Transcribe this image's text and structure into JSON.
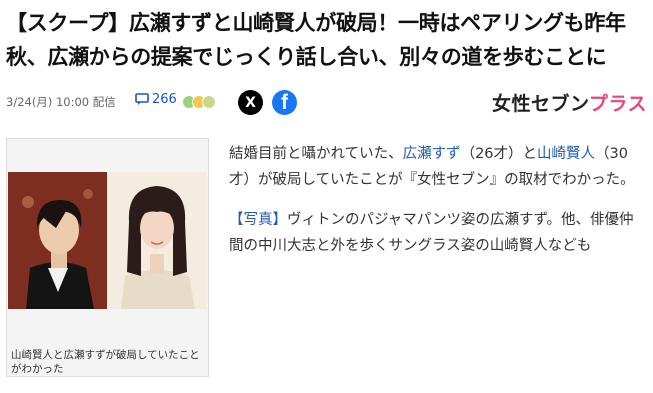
{
  "headline": {
    "line1": "【スクープ】広瀬すずと山崎賢人が破局！一時はペアリングも昨年",
    "line2": "秋、広瀬からの提案でじっくり話し合い、別々の道を歩むことに"
  },
  "meta": {
    "date": "3/24(月) 10:00 配信",
    "comment_count": "266",
    "share_x": "X",
    "share_facebook": "f",
    "reaction_colors": [
      "#9ad27c",
      "#f3c94a",
      "#c9d98b"
    ]
  },
  "brand": {
    "part1": "女性セブン",
    "part2": "プラス",
    "accent": "#e8477e"
  },
  "figure": {
    "caption": "山崎賢人と広瀬すずが破局していたことがわかった"
  },
  "article": {
    "p1_pre": "結婚目前と囁かれていた、",
    "p1_link1": "広瀬すず",
    "p1_mid": "（26才）と",
    "p1_link2": "山崎賢人",
    "p1_post": "（30才）が破局していたことが『女性セブン』の取材でわかった。",
    "p2_link": "【写真】",
    "p2_text": "ヴィトンのパジャマパンツ姿の広瀬すず。他、俳優仲間の中川大志と外を歩くサングラス姿の山崎賢人なども"
  },
  "colors": {
    "link": "#2459b4",
    "comment": "#1a55c8"
  }
}
